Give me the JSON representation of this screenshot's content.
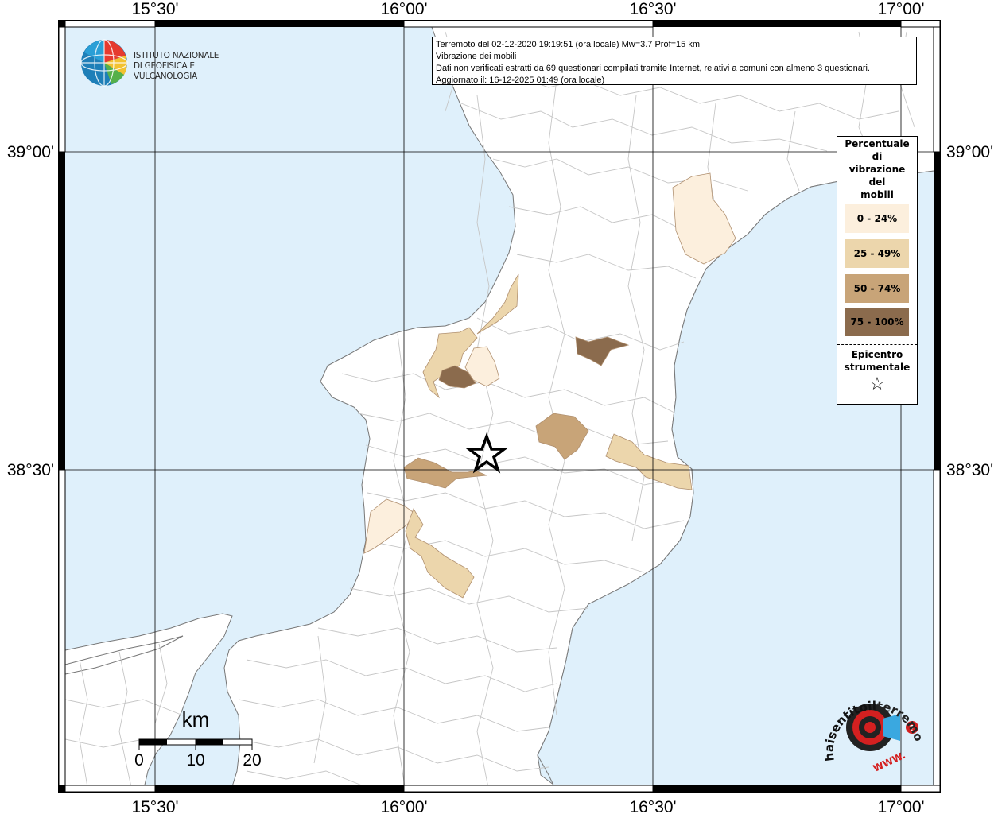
{
  "logo": {
    "line1": "ISTITUTO NAZIONALE",
    "line2": "DI GEOFISICA E VULCANOLOGIA"
  },
  "info": {
    "line1": "Terremoto del 02-12-2020 19:19:51 (ora locale) Mw=3.7 Prof=15 km",
    "line2": "Vibrazione dei mobili",
    "line3": "Dati non verificati estratti da 69 questionari compilati tramite Internet, relativi a comuni con almeno 3 questionari.",
    "line4": "Aggiornato il: 16-12-2025 01:49 (ora locale)"
  },
  "grid": {
    "lon_labels": [
      "15°30'",
      "16°00'",
      "16°30'",
      "17°00'"
    ],
    "lat_labels": [
      "39°00'",
      "38°30'"
    ]
  },
  "legend": {
    "title_lines": [
      "Percentuale",
      "di",
      "vibrazione",
      "del",
      "mobili"
    ],
    "classes": [
      {
        "label": "0 - 24%",
        "color": "#fcefdd"
      },
      {
        "label": "25 - 49%",
        "color": "#ecd6ac"
      },
      {
        "label": "50 - 74%",
        "color": "#c8a478"
      },
      {
        "label": "75 - 100%",
        "color": "#8b6b4d"
      }
    ],
    "epicenter_line1": "Epicentro",
    "epicenter_line2": "strumentale",
    "epicenter_symbol": "☆"
  },
  "scale": {
    "unit": "km",
    "ticks": [
      "0",
      "10",
      "20"
    ]
  },
  "badge": {
    "text_top": "terremoto.it",
    "text_left": "haisentitoil",
    "text_bottom": "WWW."
  },
  "colors": {
    "sea": "#dff0fb",
    "land": "#ffffff",
    "border": "#000000"
  }
}
